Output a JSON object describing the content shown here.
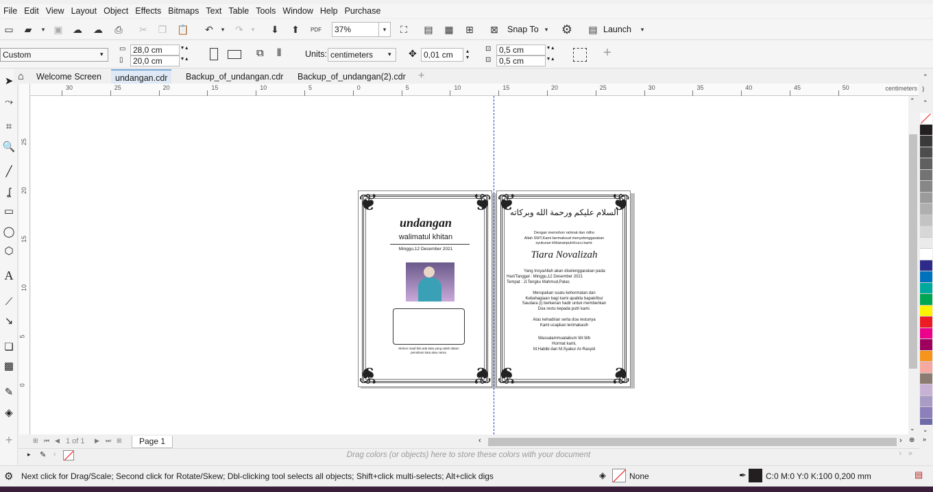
{
  "menu": [
    "File",
    "Edit",
    "View",
    "Layout",
    "Object",
    "Effects",
    "Bitmaps",
    "Text",
    "Table",
    "Tools",
    "Window",
    "Help",
    "Purchase"
  ],
  "toolbar": {
    "zoom": "37%",
    "snap_label": "Snap To",
    "launch_label": "Launch"
  },
  "props": {
    "preset": "Custom",
    "width": "28,0 cm",
    "height": "20,0 cm",
    "units_label": "Units:",
    "units": "centimeters",
    "nudge": "0,01 cm",
    "dup_x": "0,5 cm",
    "dup_y": "0,5 cm"
  },
  "tabs": [
    "Welcome Screen",
    "undangan.cdr",
    "Backup_of_undangan.cdr",
    "Backup_of_undangan(2).cdr"
  ],
  "ruler": {
    "unit": "centimeters",
    "h_ticks": [
      "30",
      "25",
      "20",
      "15",
      "10",
      "5",
      "0",
      "5",
      "10",
      "15",
      "20",
      "25",
      "30",
      "35",
      "40",
      "45",
      "50"
    ],
    "v_ticks": [
      "25",
      "20",
      "15",
      "10",
      "5",
      "0"
    ]
  },
  "cover": {
    "title": "undangan",
    "subtitle": "walimatul khitan",
    "date": "Minggu,12 Desember 2021",
    "note": "Mohon maaf bila ada kata yang salah dalam penulisan kata atau nama."
  },
  "inner": {
    "arabic": "السلام عليكم ورحمة الله وبركاته",
    "intro": [
      "Dengan memohon rahmat dan ridho",
      "Allah SWT,Kami bermaksud menyelenggarakan",
      "syukuran khitananputri/cucu kami:"
    ],
    "name": "Tiara Novalizah",
    "details": [
      "Yang InsyaAllah akan diselenggarakan pada:",
      "Hari/Tanggal : Minggu,12 Desember 2021",
      "Tempat : Jl.Tengku Mahmud,Palas"
    ],
    "body": [
      "Merupakan suatu kehormatan dan",
      "Kebahagiaan bagi kami apabila bapak/ibu/",
      "Saudara (i) berkenan hadir untuk memberikan",
      "Doa restu kepada putri kami."
    ],
    "thanks": [
      "Atas kehadiran serta doa restunya",
      "Kami ucapkan terimakasih"
    ],
    "closing": [
      "Wassalammualaikum Wr.Wb",
      "Hormat kami,",
      "M.Habibi dan M.Syakur Ar-Rasyid"
    ]
  },
  "pagenav": {
    "count": "1 of 1",
    "page_tab": "Page 1"
  },
  "docpalette": {
    "hint": "Drag colors (or objects) here to store these colors with your document"
  },
  "status": {
    "message": "Next click for Drag/Scale; Second click for Rotate/Skew; Dbl-clicking tool selects all objects; Shift+click multi-selects; Alt+click digs",
    "fill": "None",
    "outline": "C:0 M:0 Y:0 K:100  0,200 mm"
  },
  "palette_colors": [
    "#231f20",
    "#3a3a3a",
    "#4d4d4d",
    "#606060",
    "#737373",
    "#878787",
    "#9b9b9b",
    "#afafaf",
    "#c3c3c3",
    "#d7d7d7",
    "#ebebeb",
    "#ffffff",
    "#2d2a8a",
    "#0072bc",
    "#00a99d",
    "#00a651",
    "#fff200",
    "#ed1c24",
    "#ec008c",
    "#9e005d",
    "#f7941d",
    "#f5a9a0",
    "#8c7b70",
    "#c7b2d6",
    "#a99bc6",
    "#8d7fba",
    "#6f6aa8"
  ]
}
